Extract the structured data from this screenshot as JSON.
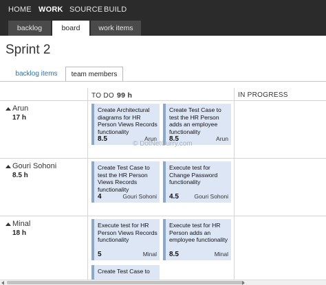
{
  "topnav": {
    "items": [
      "HOME",
      "WORK",
      "SOURCE",
      "BUILD"
    ],
    "active": "WORK"
  },
  "subtabs": [
    "backlog",
    "board",
    "work items"
  ],
  "page_title": "Sprint 2",
  "panel_tabs": [
    "backlog items",
    "team members"
  ],
  "columns": {
    "todo": {
      "label": "TO DO",
      "hours": "99 h"
    },
    "inprogress": {
      "label": "IN PROGRESS"
    }
  },
  "members": [
    {
      "name": "Arun",
      "hours": "17 h"
    },
    {
      "name": "Gouri Sohoni",
      "hours": "8.5 h"
    },
    {
      "name": "Minal",
      "hours": "18 h"
    }
  ],
  "cards": [
    {
      "title": "Create Architectural diagrams for HR Person Views Records functionality",
      "value": "8.5",
      "owner": "Arun"
    },
    {
      "title": "Create Test Case to test the HR Person adds an employee functionality",
      "value": "8.5",
      "owner": "Arun"
    },
    {
      "title": "Create Test Case to test the HR Person Views Records functionality",
      "value": "4",
      "owner": "Gouri Sohoni"
    },
    {
      "title": "Execute test for Change Password functionality",
      "value": "4.5",
      "owner": "Gouri Sohoni"
    },
    {
      "title": "Execute test for HR Person Views Records functionality",
      "value": "5",
      "owner": "Minal"
    },
    {
      "title": "Execute test for HR Person adds an employee functionality",
      "value": "8.5",
      "owner": "Minal"
    },
    {
      "title": "Create Test Case to",
      "value": "",
      "owner": ""
    }
  ],
  "watermark": "© DotNetCurry.com",
  "colors": {
    "topbar": "#2b2b2b",
    "card_bg": "#dce6f4",
    "card_accent": "#8aa7cc",
    "link": "#1e73c8"
  }
}
